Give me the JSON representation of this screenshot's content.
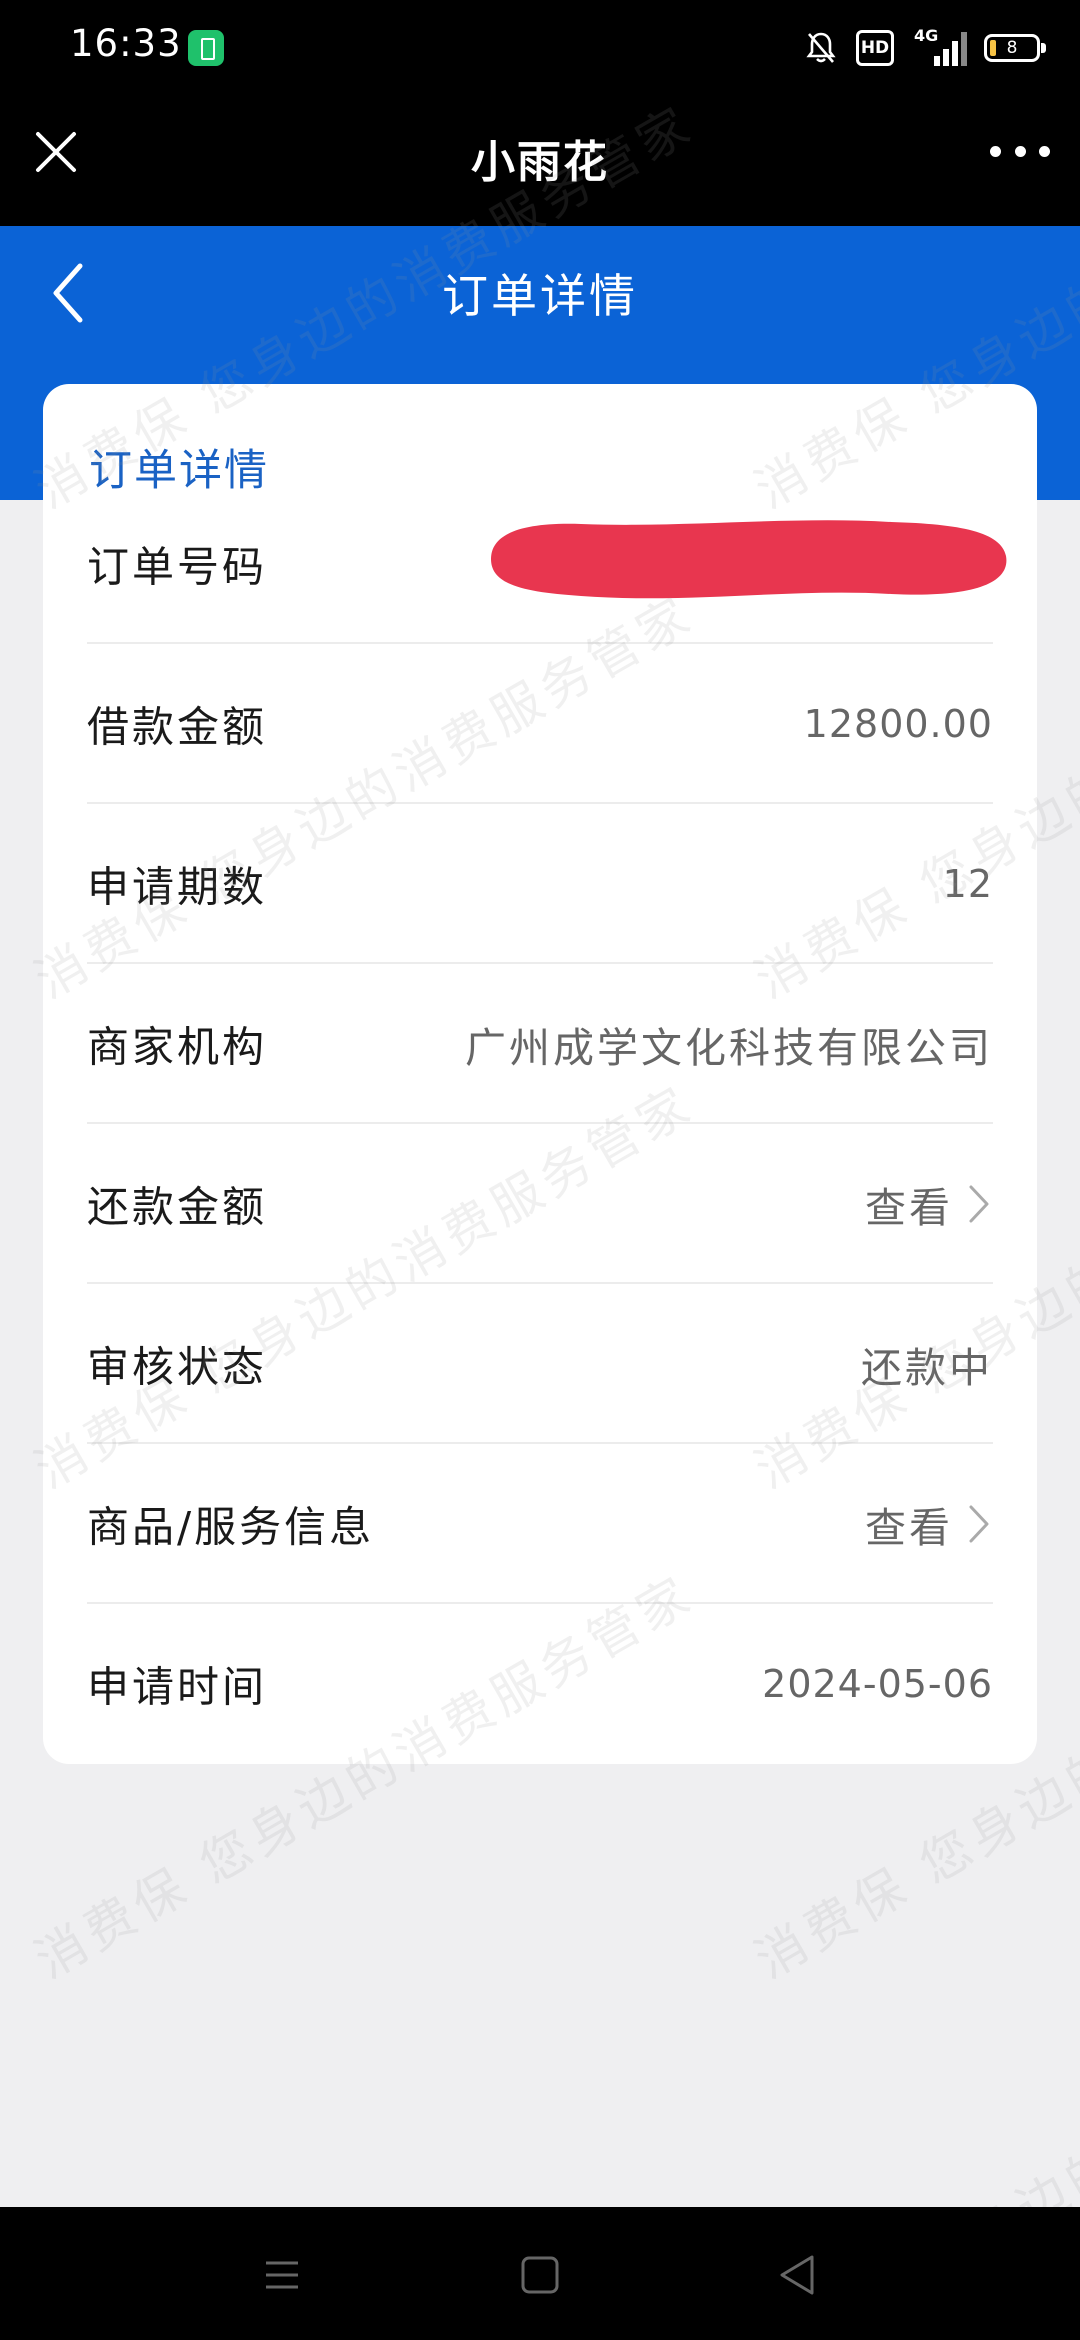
{
  "status_bar": {
    "time": "16:33",
    "network": "4G",
    "hd": "HD",
    "battery_level": "8"
  },
  "app_bar": {
    "title": "小雨花"
  },
  "header": {
    "title": "订单详情"
  },
  "card": {
    "section_title": "订单详情",
    "rows": [
      {
        "label": "订单号码",
        "value": ""
      },
      {
        "label": "借款金额",
        "value": "12800.00"
      },
      {
        "label": "申请期数",
        "value": "12"
      },
      {
        "label": "商家机构",
        "value": "广州成学文化科技有限公司"
      },
      {
        "label": "还款金额",
        "value": "查看"
      },
      {
        "label": "审核状态",
        "value": "还款中"
      },
      {
        "label": "商品/服务信息",
        "value": "查看"
      },
      {
        "label": "申请时间",
        "value": "2024-05-06"
      }
    ]
  },
  "watermark": {
    "text_a": "消费保 您身边的消费服务管家"
  },
  "colors": {
    "header_blue": "#0b63d6",
    "section_title_blue": "#1a62c4",
    "redaction_red": "#e8364f",
    "background": "#efeff1"
  }
}
